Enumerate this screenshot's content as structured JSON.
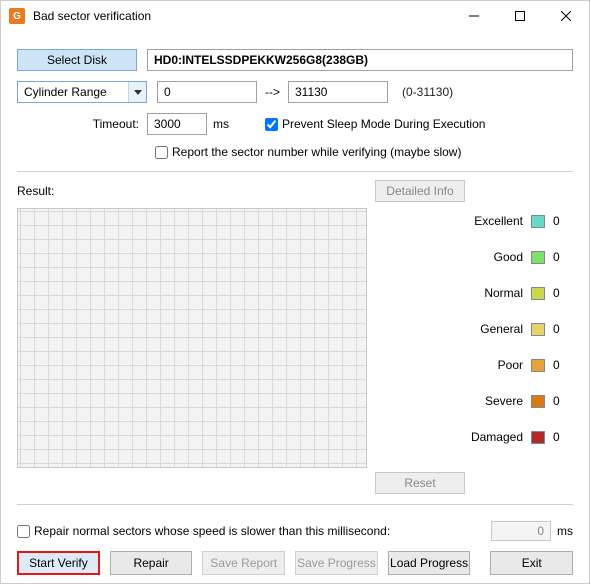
{
  "title": "Bad sector verification",
  "buttons": {
    "select_disk": "Select Disk",
    "detailed_info": "Detailed Info",
    "reset": "Reset",
    "start_verify": "Start Verify",
    "repair": "Repair",
    "save_report": "Save Report",
    "save_progress": "Save Progress",
    "load_progress": "Load Progress",
    "exit": "Exit"
  },
  "disk": "HD0:INTELSSDPEKKW256G8(238GB)",
  "range_mode": "Cylinder Range",
  "range": {
    "start": "0",
    "arrow": "-->",
    "end": "31130",
    "hint": "(0-31130)"
  },
  "timeout": {
    "label": "Timeout:",
    "value": "3000",
    "unit": "ms"
  },
  "prevent_sleep": {
    "checked": true,
    "label": "Prevent Sleep Mode During Execution"
  },
  "report_sector": {
    "checked": false,
    "label": "Report the sector number while verifying (maybe slow)"
  },
  "result_label": "Result:",
  "legend": [
    {
      "name": "Excellent",
      "class": "sw-excellent",
      "count": "0"
    },
    {
      "name": "Good",
      "class": "sw-good",
      "count": "0"
    },
    {
      "name": "Normal",
      "class": "sw-normal",
      "count": "0"
    },
    {
      "name": "General",
      "class": "sw-general",
      "count": "0"
    },
    {
      "name": "Poor",
      "class": "sw-poor",
      "count": "0"
    },
    {
      "name": "Severe",
      "class": "sw-severe",
      "count": "0"
    },
    {
      "name": "Damaged",
      "class": "sw-damaged",
      "count": "0"
    }
  ],
  "repair_ms": {
    "checked": false,
    "label": "Repair normal sectors whose speed is slower than this millisecond:",
    "value": "0",
    "unit": "ms"
  }
}
